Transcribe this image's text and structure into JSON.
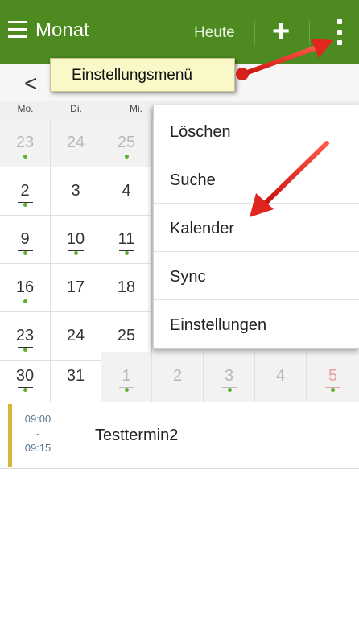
{
  "topbar": {
    "title": "Monat",
    "today_label": "Heute",
    "add_icon": "plus-icon",
    "menu_icon": "kebab-menu-icon",
    "color": "#4d8a1f"
  },
  "nav": {
    "back_icon": "chevron-left-icon",
    "back_glyph": "<"
  },
  "weekdays": [
    "Mo.",
    "Di.",
    "Mi."
  ],
  "weeks": [
    [
      "23",
      "24",
      "25"
    ],
    [
      "2",
      "3",
      "4"
    ],
    [
      "9",
      "10",
      "11"
    ],
    [
      "16",
      "17",
      "18"
    ],
    [
      "23",
      "24",
      "25"
    ],
    [
      "30",
      "31",
      "1",
      "2",
      "3",
      "4",
      "5"
    ]
  ],
  "event": {
    "time_start": "09:00",
    "time_sep": "-",
    "time_end": "09:15",
    "title": "Testtermin2",
    "color": "#d6b836"
  },
  "menu": {
    "items": [
      "Löschen",
      "Suche",
      "Kalender",
      "Sync",
      "Einstellungen"
    ]
  },
  "tooltip": {
    "label": "Einstellungsmenü"
  },
  "annotation_color": "#e0261e"
}
